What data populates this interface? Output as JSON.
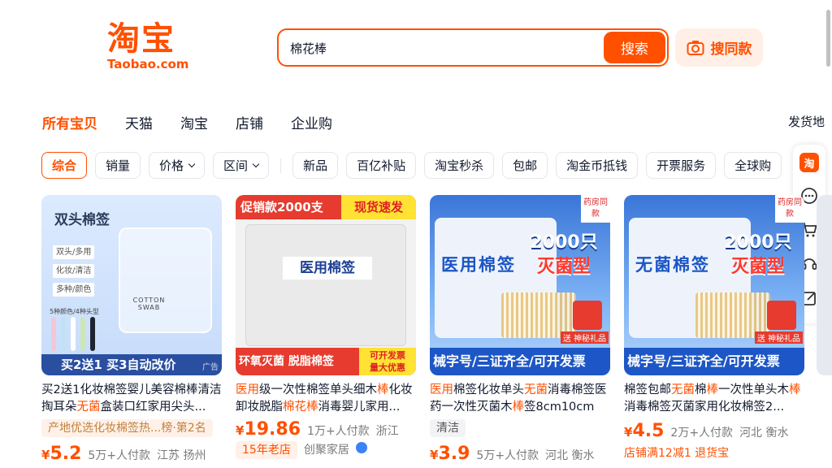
{
  "header": {
    "logo_cn": "淘宝",
    "logo_en": "Taobao.com",
    "search_value": "棉花棒",
    "search_button": "搜索",
    "same_button": "搜同款"
  },
  "tabs": [
    "所有宝贝",
    "天猫",
    "淘宝",
    "店铺",
    "企业购"
  ],
  "ship_from": "发货地",
  "filters": {
    "items": [
      "综合",
      "销量",
      "价格",
      "区间",
      "新品",
      "百亿补贴",
      "淘宝秒杀",
      "包邮",
      "淘金币抵钱",
      "开票服务",
      "全球购"
    ]
  },
  "right_bar": {
    "logo": "淘"
  },
  "products": [
    {
      "title_parts": [
        "买2送1化妆棉签婴儿美容棉棒清洁掏耳朵",
        "无菌",
        "盒装口红家用尖头..."
      ],
      "tag": "产地优选化妆棉签热...榜·第2名",
      "price_symbol": "¥",
      "price": "5.2",
      "sales": "5万+人付款",
      "location": "江苏 扬州",
      "thumb": {
        "head": "双头棉签",
        "pills": [
          "双头/多用",
          "化妆/清洁",
          "多种/颜色"
        ],
        "box_label": "COTTON SWAB",
        "note": "5种颜色/4种头型",
        "strip": "买2送1  买3自动改价",
        "ad": "广告"
      }
    },
    {
      "title_parts": [
        "医用",
        "级一次性棉签单头细木",
        "棒",
        "化妆卸妆脱脂",
        "棉花棒",
        "消毒婴儿家用..."
      ],
      "tag": "",
      "price_symbol": "¥",
      "price": "19.86",
      "sales": "1万+人付款",
      "location": "浙江",
      "badge": "15年老店",
      "shop": "创聚家居",
      "thumb": {
        "banner": "促销款2000支",
        "banner_y": "现货速发",
        "bag_title": "医用棉签",
        "bottom": "环氧灭菌 脱脂棉签",
        "bottom_y1": "可开发票",
        "bottom_y2": "量大优惠"
      }
    },
    {
      "title_parts": [
        "医用",
        "棉签化妆单头",
        "无菌",
        "消毒棉签医药一次性灭菌木",
        "棒",
        "签8cm10cm"
      ],
      "tag": "清洁",
      "price_symbol": "¥",
      "price": "3.9",
      "sales": "5万+人付款",
      "location": "河北 衡水",
      "thumb": {
        "bag_title": "医用棉签",
        "big1": "2000只",
        "big2": "灭菌型",
        "corner": "药房同款",
        "gift": "送 神秘礼品",
        "bottom": "械字号/三证齐全/可开发票"
      }
    },
    {
      "title_parts": [
        "棉签包邮",
        "无菌",
        "棉",
        "棒",
        "一次性单头木",
        "棒",
        "消毒棉签灭菌家用化妆棉签2..."
      ],
      "tag": "店铺满12减1  退货宝",
      "price_symbol": "¥",
      "price": "4.5",
      "sales": "2万+人付款",
      "location": "河北 衡水",
      "thumb": {
        "bag_title": "无菌棉签",
        "big1": "2000只",
        "big2": "灭菌型",
        "corner": "药房同款",
        "gift": "送 神秘礼品",
        "bottom": "械字号/三证齐全/可开发票"
      }
    }
  ],
  "colors": {
    "accent": "#ff5000"
  }
}
